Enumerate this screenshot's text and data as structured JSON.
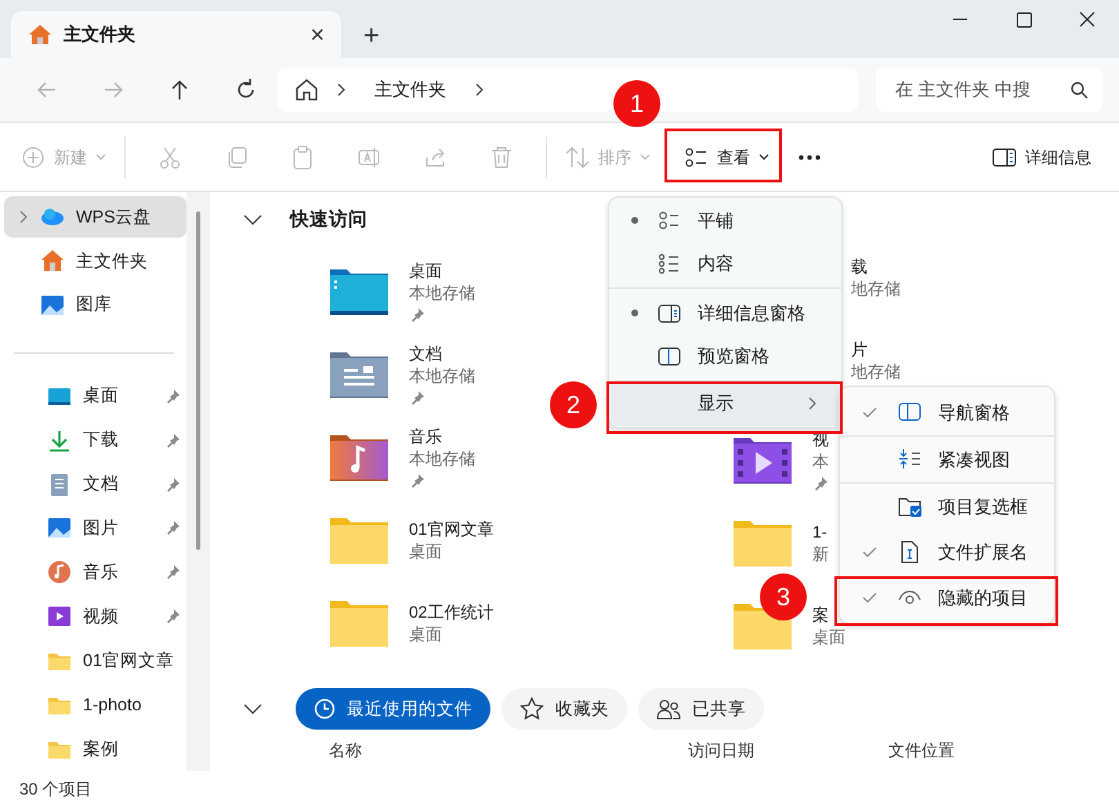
{
  "tab": {
    "title": "主文件夹",
    "close": "×",
    "new_tab": "+"
  },
  "nav_buttons": [
    {
      "disabled": true
    },
    {
      "disabled": true
    },
    {
      "disabled": false
    },
    {
      "disabled": false
    }
  ],
  "breadcrumb": [
    "主文件夹"
  ],
  "search": {
    "placeholder": "在 主文件夹 中搜"
  },
  "toolbar": [
    {
      "label": "新建",
      "disabled": true,
      "dropdown": true
    },
    {
      "disabled": true
    },
    {
      "disabled": true
    },
    {
      "disabled": true
    },
    {
      "disabled": true
    },
    {
      "disabled": true
    },
    {
      "disabled": true
    },
    {
      "label": "排序",
      "disabled": true,
      "dropdown": true
    },
    {
      "label": "查看",
      "disabled": false,
      "dropdown": true
    },
    {
      "disabled": false
    }
  ],
  "details_button": "详细信息",
  "sidebar": {
    "items": [
      {
        "label": "WPS云盘",
        "selected": true,
        "expandable": true
      },
      {
        "label": "主文件夹",
        "selected": false
      },
      {
        "label": "图库",
        "selected": false
      }
    ],
    "pinned": [
      {
        "label": "桌面",
        "pinned": true
      },
      {
        "label": "下载",
        "pinned": true
      },
      {
        "label": "文档",
        "pinned": true
      },
      {
        "label": "图片",
        "pinned": true
      },
      {
        "label": "音乐",
        "pinned": true
      },
      {
        "label": "视频",
        "pinned": true
      },
      {
        "label": "01官网文章",
        "pinned": false
      },
      {
        "label": "1-photo",
        "pinned": false
      },
      {
        "label": "案例",
        "pinned": false
      }
    ]
  },
  "quick_access": {
    "title": "快速访问",
    "items": [
      {
        "name": "桌面",
        "location": "本地存储",
        "pinned": true
      },
      {
        "name": "载",
        "location": "地存储",
        "kind": "covered"
      },
      {
        "name": "文档",
        "location": "本地存储",
        "pinned": true
      },
      {
        "name": "片",
        "location": "地存储",
        "kind": "covered"
      },
      {
        "name": "音乐",
        "location": "本地存储",
        "pinned": true
      },
      {
        "name": "视",
        "location": "本",
        "kind": "partial",
        "pinned": true
      },
      {
        "name": "01官网文章",
        "location": "桌面",
        "pinned": false
      },
      {
        "name": "1-",
        "location": "新",
        "kind": "partial",
        "pinned": false
      },
      {
        "name": "02工作统计",
        "location": "桌面",
        "pinned": false
      },
      {
        "name": "案",
        "location": "桌面",
        "kind": "partial",
        "pinned": false
      }
    ]
  },
  "recent_tabs": [
    {
      "label": "最近使用的文件",
      "selected": true
    },
    {
      "label": "收藏夹",
      "selected": false
    },
    {
      "label": "已共享",
      "selected": false
    }
  ],
  "columns": [
    "名称",
    "访问日期",
    "文件位置"
  ],
  "status_bar": "30 个项目",
  "view_menu": {
    "items": [
      {
        "label": "平铺",
        "bullet": true
      },
      {
        "label": "内容",
        "bullet": false,
        "divider_after": true
      },
      {
        "label": "详细信息窗格",
        "bullet": true
      },
      {
        "label": "预览窗格",
        "bullet": false
      },
      {
        "label": "显示",
        "submenu": true,
        "highlighted": true
      }
    ]
  },
  "show_submenu": {
    "items": [
      {
        "label": "导航窗格",
        "checked": true,
        "divider_after": true
      },
      {
        "label": "紧凑视图",
        "checked": false,
        "divider_after": true
      },
      {
        "label": "项目复选框",
        "checked": false
      },
      {
        "label": "文件扩展名",
        "checked": true
      },
      {
        "label": "隐藏的项目",
        "checked": true
      }
    ]
  },
  "step_badges": [
    "1",
    "2",
    "3"
  ]
}
